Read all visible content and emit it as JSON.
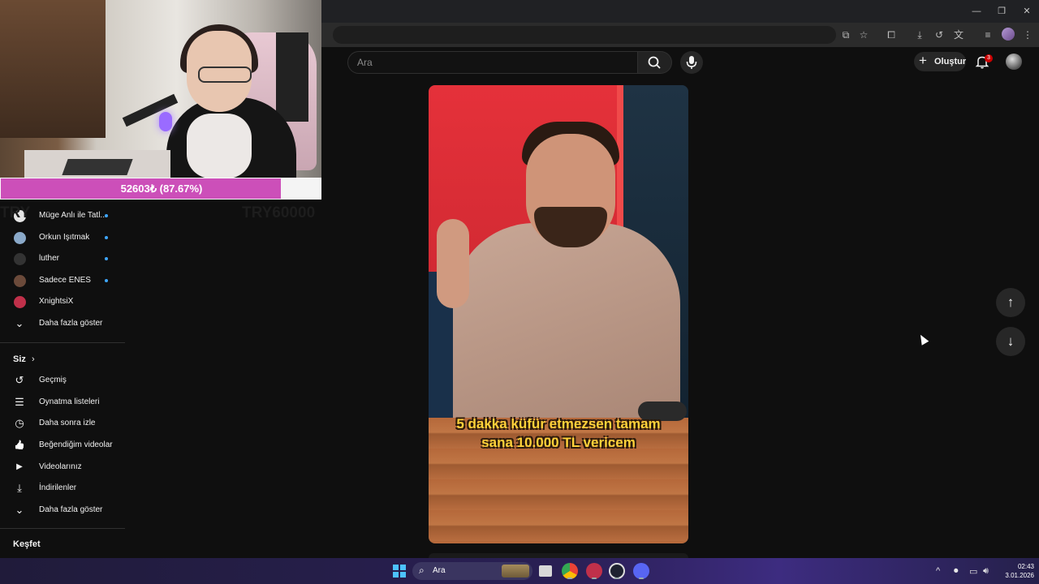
{
  "search": {
    "placeholder": "Ara"
  },
  "header": {
    "create_label": "Oluştur",
    "notification_count": "3"
  },
  "donation": {
    "progress_label": "52603₺ (87.67%)",
    "progress_fraction": 0.8767,
    "left_label": "TRY",
    "goal_label": "TRY60000"
  },
  "subscriptions": [
    {
      "label": "Müge Anlı ile Tatl...",
      "live": true,
      "color": "#e5e5e5"
    },
    {
      "label": "Orkun Işıtmak",
      "live": true,
      "color": "#8aa9c9"
    },
    {
      "label": "luther",
      "live": true,
      "color": "#333333"
    },
    {
      "label": "Sadece ENES",
      "live": true,
      "color": "#6b4a3a"
    },
    {
      "label": "XnightsiX",
      "live": false,
      "color": "#c0304a"
    }
  ],
  "subscriptions_more": "Daha fazla göster",
  "you": {
    "title": "Siz",
    "items": [
      {
        "label": "Geçmiş",
        "icon": "history-icon",
        "glyph": "↺"
      },
      {
        "label": "Oynatma listeleri",
        "icon": "playlist-icon",
        "glyph": "☰"
      },
      {
        "label": "Daha sonra izle",
        "icon": "watch-later-icon",
        "glyph": "◷"
      },
      {
        "label": "Beğendiğim videolar",
        "icon": "thumbs-up-icon",
        "glyph": "👍"
      },
      {
        "label": "Videolarınız",
        "icon": "your-videos-icon",
        "glyph": "▶"
      },
      {
        "label": "İndirilenler",
        "icon": "download-icon",
        "glyph": "⤓"
      }
    ],
    "more": "Daha fazla göster"
  },
  "explore": {
    "title": "Keşfet"
  },
  "video": {
    "caption": "5 dakka küfür etmezsen tamam sana 10.000 TL vericem"
  },
  "taskbar": {
    "search_label": "Ara",
    "time": "02:43",
    "date": "3.01.2026"
  }
}
